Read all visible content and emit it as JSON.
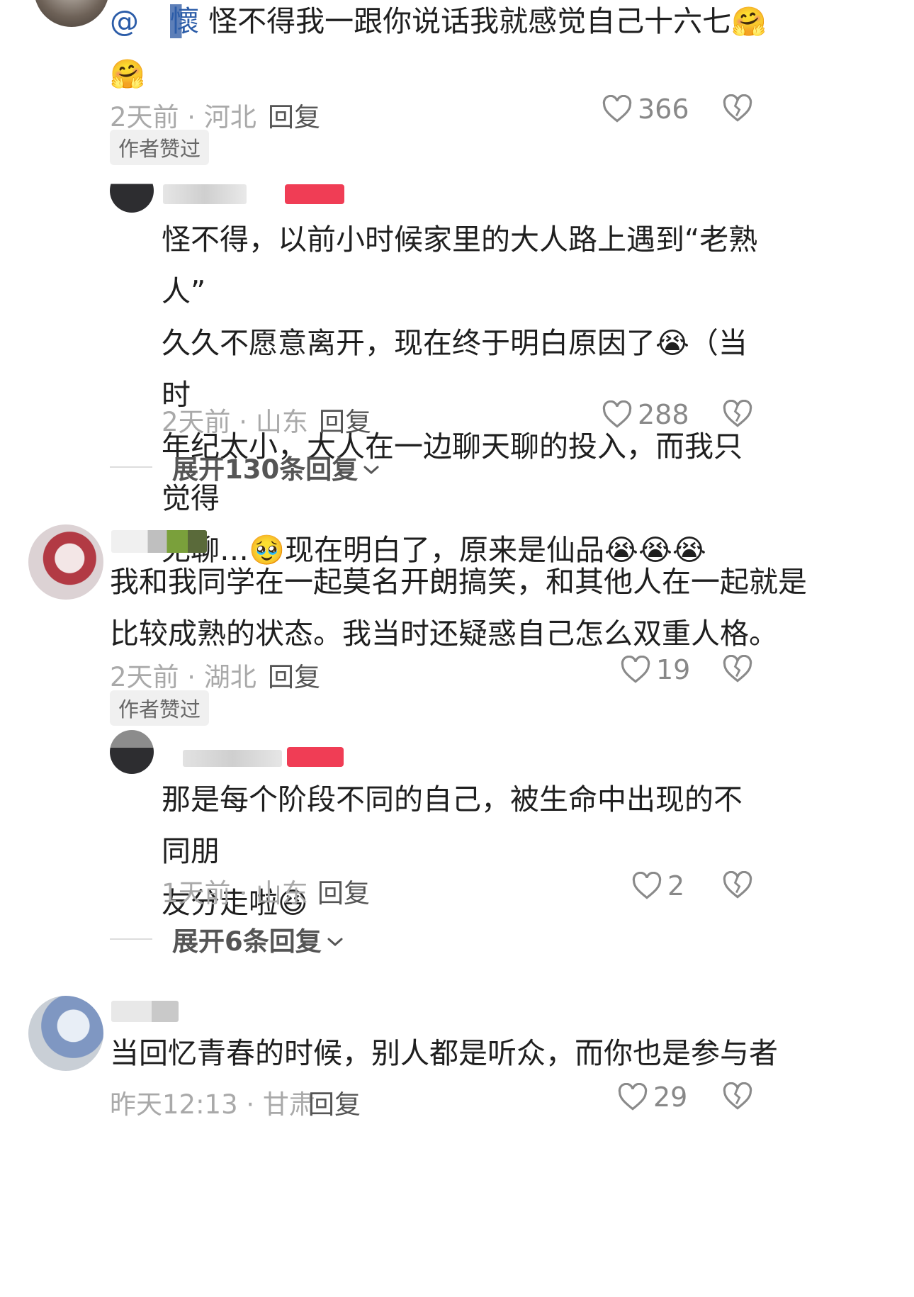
{
  "comments": [
    {
      "mention": "@",
      "mention_name": "懷",
      "text": "怪不得我一跟你说话我就感觉自己十六七",
      "emoji": "🤗🤗",
      "time": "2天前 · 河北",
      "reply_label": "回复",
      "likes": "366",
      "badge": "作者赞过",
      "sub": {
        "text_line1": "怪不得，以前小时候家里的大人路上遇到“老熟人”",
        "text_line2": "久久不愿意离开，现在终于明白原因了😭（当时",
        "text_line3": "年纪太小，大人在一边聊天聊的投入，而我只觉得",
        "text_line4": "无聊…🥹现在明白了，原来是仙品😭😭😭",
        "time": "2天前 · 山东",
        "reply_label": "回复",
        "likes": "288",
        "expand": "展开130条回复"
      }
    },
    {
      "text_line1": "我和我同学在一起莫名开朗搞笑，和其他人在一起就是",
      "text_line2": "比较成熟的状态。我当时还疑惑自己怎么双重人格。",
      "time": "2天前 · 湖北",
      "reply_label": "回复",
      "likes": "19",
      "badge": "作者赞过",
      "sub": {
        "text_line1": "那是每个阶段不同的自己，被生命中出现的不同朋",
        "text_line2": "友分走啦😆",
        "time": "1天前 · 山东",
        "reply_label": "回复",
        "likes": "2",
        "expand": "展开6条回复"
      }
    },
    {
      "text_line1": "当回忆青春的时候，别人都是听众，而你也是参与者",
      "time": "昨天12:13 · 甘肃",
      "reply_label": "回复",
      "likes": "29"
    }
  ],
  "icons": {
    "like": "heart-outline-icon",
    "dislike": "broken-heart-icon",
    "expand": "chevron-down-icon"
  }
}
